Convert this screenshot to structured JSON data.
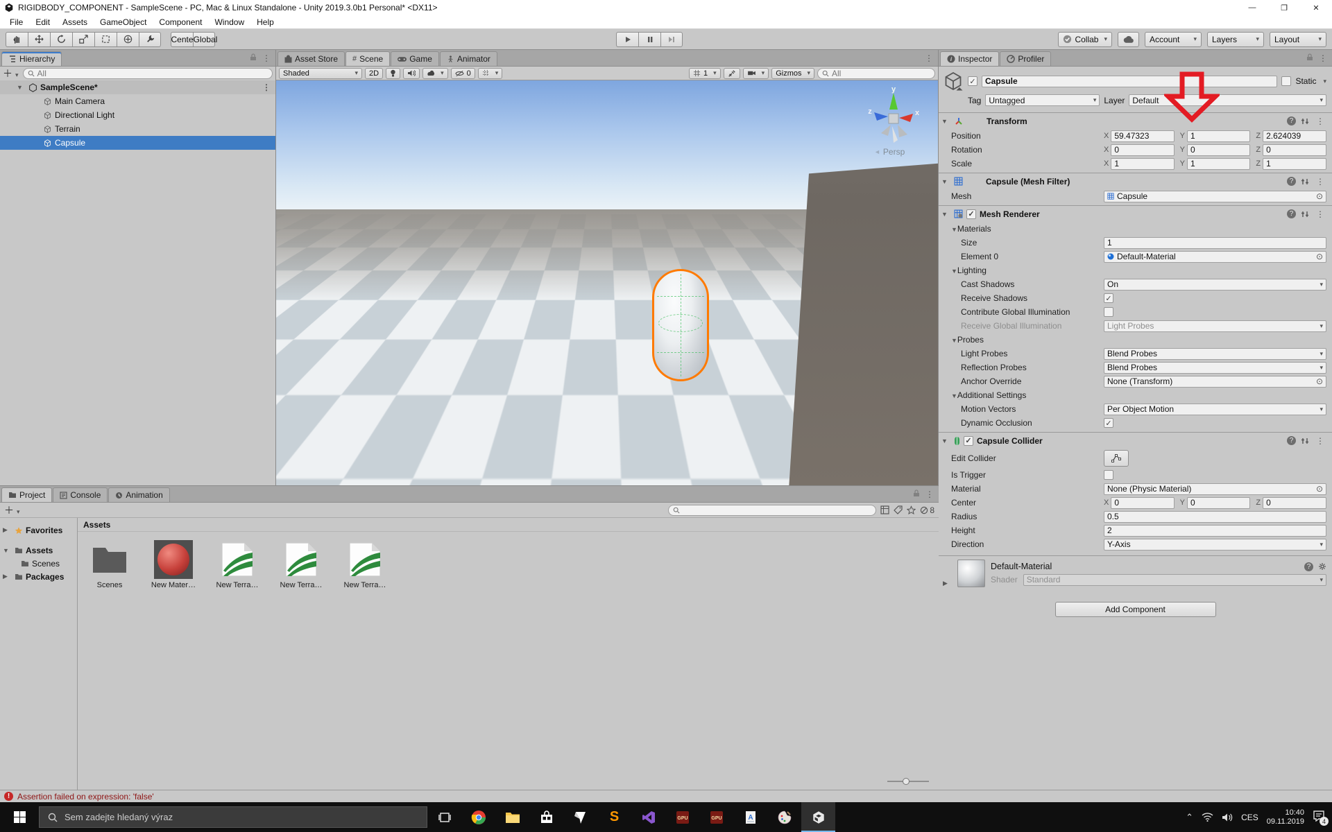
{
  "title_bar": {
    "title": "RIGIDBODY_COMPONENT - SampleScene - PC, Mac & Linux Standalone - Unity 2019.3.0b1 Personal* <DX11>",
    "minimize": "—",
    "maximize": "❐",
    "close": "✕"
  },
  "menu_bar": {
    "items": [
      "File",
      "Edit",
      "Assets",
      "GameObject",
      "Component",
      "Window",
      "Help"
    ]
  },
  "toolbar": {
    "tools": [
      "hand-tool",
      "move-tool",
      "rotate-tool",
      "scale-tool",
      "rect-tool",
      "transform-tool",
      "custom-tool"
    ],
    "center_label": "Center",
    "global_label": "Global",
    "collab_label": "Collab",
    "account_label": "Account",
    "layers_label": "Layers",
    "layout_label": "Layout"
  },
  "hierarchy": {
    "tab": "Hierarchy",
    "search_text": "All",
    "scene_name": "SampleScene*",
    "items": [
      "Main Camera",
      "Directional Light",
      "Terrain",
      "Capsule"
    ]
  },
  "scene_view": {
    "tabs": [
      "Asset Store",
      "Scene",
      "Game",
      "Animator"
    ],
    "shading_mode": "Shaded",
    "toggle_2d": "2D",
    "hidden_count": "0",
    "grid_value": "1",
    "gizmos_label": "Gizmos",
    "search_text": "All",
    "persp_label": "Persp",
    "axis_x": "x",
    "axis_y": "y",
    "axis_z": "z"
  },
  "inspector": {
    "tabs": [
      "Inspector",
      "Profiler"
    ],
    "header": {
      "name": "Capsule",
      "static_label": "Static",
      "tag_label": "Tag",
      "tag": "Untagged",
      "layer_label": "Layer",
      "layer": "Default"
    },
    "axis": {
      "x": "X",
      "y": "Y",
      "z": "Z"
    },
    "transform": {
      "title": "Transform",
      "rows": [
        {
          "label": "Position",
          "x": "59.47323",
          "y": "1",
          "z": "2.624039"
        },
        {
          "label": "Rotation",
          "x": "0",
          "y": "0",
          "z": "0"
        },
        {
          "label": "Scale",
          "x": "1",
          "y": "1",
          "z": "1"
        }
      ]
    },
    "mesh_filter": {
      "title": "Capsule (Mesh Filter)",
      "mesh_label": "Mesh",
      "mesh": "Capsule"
    },
    "mesh_renderer": {
      "title": "Mesh Renderer",
      "materials_label": "Materials",
      "size_label": "Size",
      "size": "1",
      "element0_label": "Element 0",
      "element0": "Default-Material",
      "lighting_label": "Lighting",
      "cast_shadows_label": "Cast Shadows",
      "cast_shadows": "On",
      "receive_shadows_label": "Receive Shadows",
      "contribute_gi_label": "Contribute Global Illumination",
      "receive_gi_label": "Receive Global Illumination",
      "receive_gi": "Light Probes",
      "probes_label": "Probes",
      "light_probes_label": "Light Probes",
      "light_probes": "Blend Probes",
      "reflection_probes_label": "Reflection Probes",
      "reflection_probes": "Blend Probes",
      "anchor_label": "Anchor Override",
      "anchor": "None (Transform)",
      "additional_label": "Additional Settings",
      "motion_vectors_label": "Motion Vectors",
      "motion_vectors": "Per Object Motion",
      "dynamic_occlusion_label": "Dynamic Occlusion"
    },
    "capsule_collider": {
      "title": "Capsule Collider",
      "edit_collider_label": "Edit Collider",
      "is_trigger_label": "Is Trigger",
      "material_label": "Material",
      "material": "None (Physic Material)",
      "center_label": "Center",
      "center_x": "0",
      "center_y": "0",
      "center_z": "0",
      "radius_label": "Radius",
      "radius": "0.5",
      "height_label": "Height",
      "height": "2",
      "direction_label": "Direction",
      "direction": "Y-Axis"
    },
    "material_preview": {
      "name": "Default-Material",
      "shader_label": "Shader",
      "shader": "Standard"
    },
    "add_component_label": "Add Component"
  },
  "project": {
    "tabs": [
      "Project",
      "Console",
      "Animation"
    ],
    "tree": {
      "favorites": "Favorites",
      "assets": "Assets",
      "scenes": "Scenes",
      "packages": "Packages"
    },
    "assets_header": "Assets",
    "items": [
      "Scenes",
      "New Mater…",
      "New Terra…",
      "New Terra…",
      "New Terra…"
    ],
    "hidden_count": "8"
  },
  "status_bar": {
    "message": "Assertion failed on expression: 'false'"
  },
  "taskbar": {
    "search_placeholder": "Sem zadejte hledaný výraz",
    "icons": [
      "task-view",
      "chrome",
      "file-explorer",
      "store",
      "mail",
      "sublime-text",
      "visual-studio",
      "gpu-z",
      "gpu-z",
      "wordpad",
      "paint",
      "unity"
    ],
    "lang": "CES",
    "time": "10:40",
    "date": "09.11.2019",
    "notification_count": "4"
  },
  "annotation": {
    "arrow_color": "#e31b23"
  }
}
